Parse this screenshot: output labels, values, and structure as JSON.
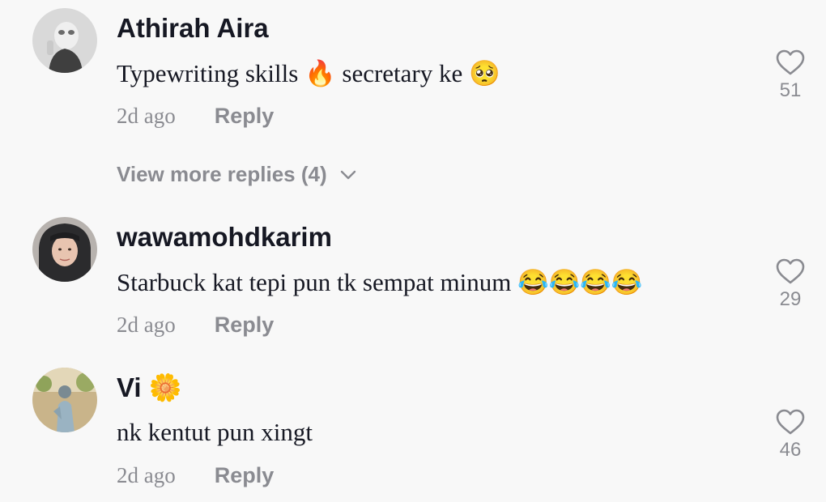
{
  "comments": [
    {
      "username": "Athirah Aira",
      "text": "Typewriting skills 🔥 secretary ke 🥺",
      "time": "2d ago",
      "reply_label": "Reply",
      "like_count": "51"
    },
    {
      "username": "wawamohdkarim",
      "text": "Starbuck kat tepi pun tk sempat minum 😂😂😂😂",
      "time": "2d ago",
      "reply_label": "Reply",
      "like_count": "29"
    },
    {
      "username": "Vi 🌼",
      "text": "nk kentut pun xingt",
      "time": "2d ago",
      "reply_label": "Reply",
      "like_count": "46"
    }
  ],
  "view_more_replies": "View more replies (4)",
  "icons": {
    "like": "heart-outline-icon",
    "expand": "chevron-down-icon"
  },
  "colors": {
    "background": "#f8f8f8",
    "primary_text": "#161823",
    "secondary_text": "#8a8b91"
  }
}
